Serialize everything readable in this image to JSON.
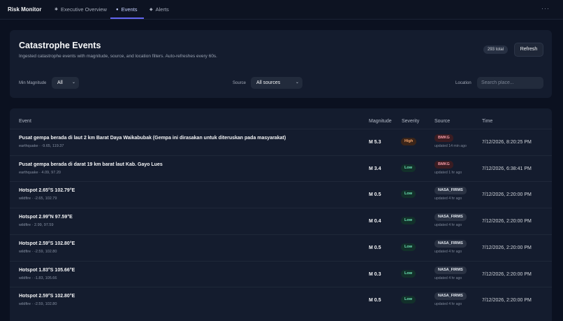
{
  "app": {
    "title": "Risk Monitor"
  },
  "nav": {
    "tabs": [
      {
        "label": "Executive Overview",
        "icon": "star-icon"
      },
      {
        "label": "Events",
        "icon": "dot-icon",
        "active": true
      },
      {
        "label": "Alerts",
        "icon": "diamond-icon"
      }
    ],
    "more": "···"
  },
  "header": {
    "title": "Catastrophe Events",
    "subtitle": "Ingested catastrophe events with magnitude, source, and location filters. Auto-refreshes every 60s.",
    "total_badge": "293 total",
    "refresh_label": "Refresh"
  },
  "filters": {
    "min_magnitude_label": "Min Magnitude",
    "min_magnitude_value": "All",
    "source_label": "Source",
    "source_value": "All sources",
    "location_label": "Location",
    "location_placeholder": "Search place..."
  },
  "table": {
    "columns": [
      "Event",
      "Magnitude",
      "Severity",
      "Source",
      "Time"
    ],
    "rows": [
      {
        "title": "Pusat gempa berada di laut 2 km Barat Daya Waikabubak (Gempa ini dirasakan untuk diteruskan pada masyarakat)",
        "sub": "earthquake · -9.65, 119.37",
        "magnitude": "M 5.3",
        "severity": "High",
        "source": "BMKG",
        "updated": "updated 14 min ago",
        "time": "7/12/2026, 8:20:25 PM"
      },
      {
        "title": "Pusat gempa berada di darat 19 km barat laut Kab. Gayo Lues",
        "sub": "earthquake · 4.09, 97.20",
        "magnitude": "M 3.4",
        "severity": "Low",
        "source": "BMKG",
        "updated": "updated 1 hr ago",
        "time": "7/12/2026, 6:38:41 PM"
      },
      {
        "title": "Hotspot 2.65°S 102.79°E",
        "sub": "wildfire · -2.65, 102.79",
        "magnitude": "M 0.5",
        "severity": "Low",
        "source": "NASA_FIRMS",
        "updated": "updated 4 hr ago",
        "time": "7/12/2026, 2:20:00 PM"
      },
      {
        "title": "Hotspot 2.99°N 97.59°E",
        "sub": "wildfire · 2.99, 97.59",
        "magnitude": "M 0.4",
        "severity": "Low",
        "source": "NASA_FIRMS",
        "updated": "updated 4 hr ago",
        "time": "7/12/2026, 2:20:00 PM"
      },
      {
        "title": "Hotspot 2.59°S 102.80°E",
        "sub": "wildfire · -2.59, 102.80",
        "magnitude": "M 0.5",
        "severity": "Low",
        "source": "NASA_FIRMS",
        "updated": "updated 4 hr ago",
        "time": "7/12/2026, 2:20:00 PM"
      },
      {
        "title": "Hotspot 1.83°S 105.66°E",
        "sub": "wildfire · -1.83, 105.66",
        "magnitude": "M 0.3",
        "severity": "Low",
        "source": "NASA_FIRMS",
        "updated": "updated 4 hr ago",
        "time": "7/12/2026, 2:20:00 PM"
      },
      {
        "title": "Hotspot 2.59°S 102.80°E",
        "sub": "wildfire · -2.59, 102.80",
        "magnitude": "M 0.5",
        "severity": "Low",
        "source": "NASA_FIRMS",
        "updated": "updated 4 hr ago",
        "time": "7/12/2026, 2:20:00 PM"
      }
    ]
  }
}
